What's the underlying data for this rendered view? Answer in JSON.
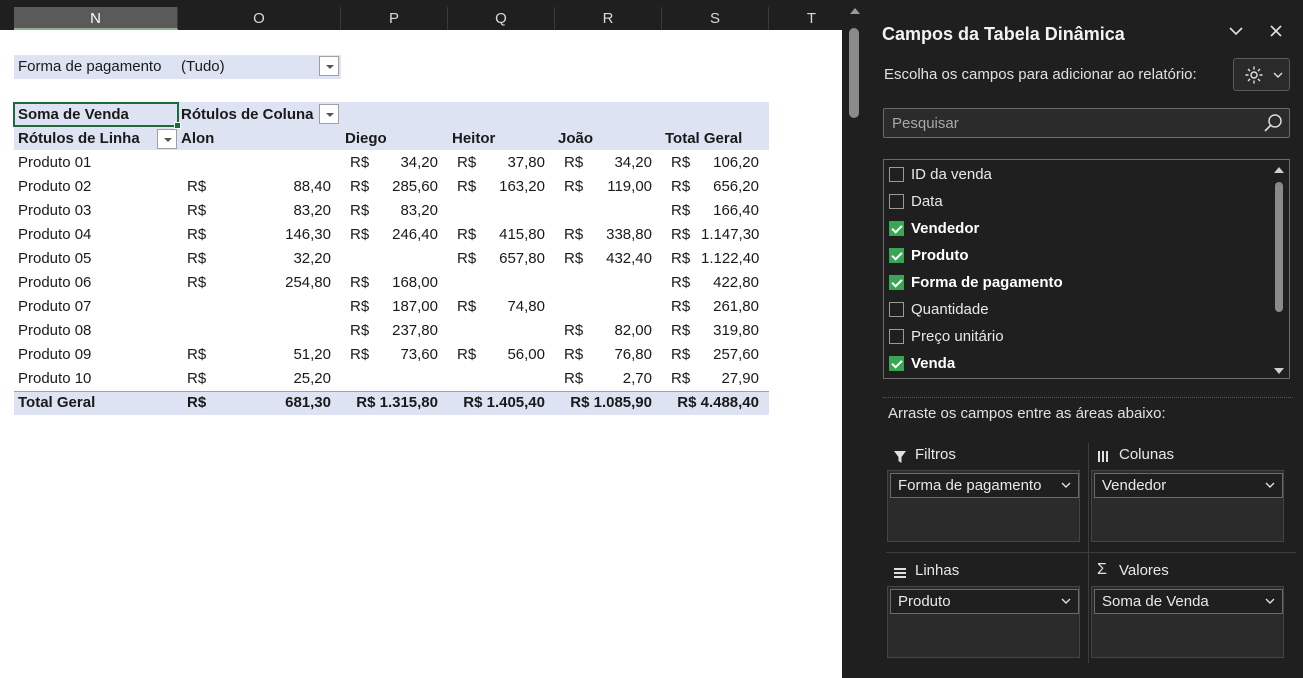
{
  "sheet": {
    "columns": [
      "N",
      "O",
      "P",
      "Q",
      "R",
      "S",
      "T"
    ],
    "selected_column": "N",
    "filter": {
      "label": "Forma de pagamento",
      "value": "(Tudo)"
    },
    "pivot": {
      "values_label": "Soma de Venda",
      "col_labels_title": "Rótulos de Coluna",
      "row_labels_title": "Rótulos de Linha",
      "sellers": [
        "Alon",
        "Diego",
        "Heitor",
        "João"
      ],
      "grand_total_header": "Total Geral",
      "currency": "R$",
      "rows": [
        {
          "label": "Produto 01",
          "values": [
            "",
            "34,20",
            "37,80",
            "34,20",
            "106,20"
          ]
        },
        {
          "label": "Produto 02",
          "values": [
            "88,40",
            "285,60",
            "163,20",
            "119,00",
            "656,20"
          ]
        },
        {
          "label": "Produto 03",
          "values": [
            "83,20",
            "83,20",
            "",
            "",
            "166,40"
          ]
        },
        {
          "label": "Produto 04",
          "values": [
            "146,30",
            "246,40",
            "415,80",
            "338,80",
            "1.147,30"
          ]
        },
        {
          "label": "Produto 05",
          "values": [
            "32,20",
            "",
            "657,80",
            "432,40",
            "1.122,40"
          ]
        },
        {
          "label": "Produto 06",
          "values": [
            "254,80",
            "168,00",
            "",
            "",
            "422,80"
          ]
        },
        {
          "label": "Produto 07",
          "values": [
            "",
            "187,00",
            "74,80",
            "",
            "261,80"
          ]
        },
        {
          "label": "Produto 08",
          "values": [
            "",
            "237,80",
            "",
            "82,00",
            "319,80"
          ]
        },
        {
          "label": "Produto 09",
          "values": [
            "51,20",
            "73,60",
            "56,00",
            "76,80",
            "257,60"
          ]
        },
        {
          "label": "Produto 10",
          "values": [
            "25,20",
            "",
            "",
            "2,70",
            "27,90"
          ]
        }
      ],
      "total_row": {
        "label": "Total Geral",
        "alon": "R$",
        "alon_value": "681,30",
        "diego": "R$ 1.315,80",
        "heitor": "R$ 1.405,40",
        "joao": "R$ 1.085,90",
        "total": "R$ 4.488,40"
      }
    }
  },
  "pane": {
    "title": "Campos da Tabela Dinâmica",
    "subtitle": "Escolha os campos para adicionar ao relatório:",
    "search_placeholder": "Pesquisar",
    "fields": [
      {
        "name": "ID da venda",
        "checked": false
      },
      {
        "name": "Data",
        "checked": false
      },
      {
        "name": "Vendedor",
        "checked": true
      },
      {
        "name": "Produto",
        "checked": true
      },
      {
        "name": "Forma de pagamento",
        "checked": true
      },
      {
        "name": "Quantidade",
        "checked": false
      },
      {
        "name": "Preço unitário",
        "checked": false
      },
      {
        "name": "Venda",
        "checked": true
      }
    ],
    "drag_label": "Arraste os campos entre as áreas abaixo:",
    "areas": {
      "filters": {
        "title": "Filtros",
        "item": "Forma de pagamento"
      },
      "columns": {
        "title": "Colunas",
        "item": "Vendedor"
      },
      "rows": {
        "title": "Linhas",
        "item": "Produto"
      },
      "values": {
        "title": "Valores",
        "item": "Soma de Venda"
      }
    }
  }
}
